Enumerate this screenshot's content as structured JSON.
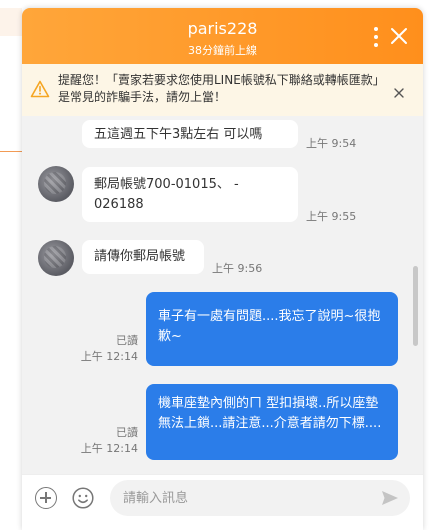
{
  "header": {
    "name": "paris228",
    "status": "38分鐘前上線"
  },
  "warning": {
    "text": "提醒您！「賣家若要求您使用LINE帳號私下聯絡或轉帳匯款」是常見的詐騙手法，請勿上當！"
  },
  "messages": [
    {
      "dir": "in",
      "text": "五這週五下午3點左右 可以嗎",
      "time": "上午 9:54"
    },
    {
      "dir": "in",
      "text_line1": "郵局帳號700-01015、 -",
      "text_line2": "026188",
      "time": "上午 9:55"
    },
    {
      "dir": "in",
      "text": "請傳你郵局帳號",
      "time": "上午 9:56"
    },
    {
      "dir": "out",
      "text": "車子有一處有問題....我忘了說明~很抱歉~",
      "read": "已讀",
      "time": "上午 12:14"
    },
    {
      "dir": "out",
      "text": "機車座墊內側的ㄇ 型扣損壞..所以座墊無法上鎖...請注意...介意者請勿下標....",
      "read": "已讀",
      "time": "上午 12:14"
    }
  ],
  "footer": {
    "placeholder": "請輸入訊息"
  },
  "colors": {
    "header_start": "#ffa63a",
    "header_end": "#ff8f1c",
    "outgoing_bubble": "#2b7de9",
    "warning_bg": "#fdf6e6"
  },
  "icons": [
    "more-vertical-icon",
    "close-icon",
    "warning-icon",
    "dismiss-icon",
    "add-icon",
    "emoji-icon",
    "send-icon"
  ]
}
